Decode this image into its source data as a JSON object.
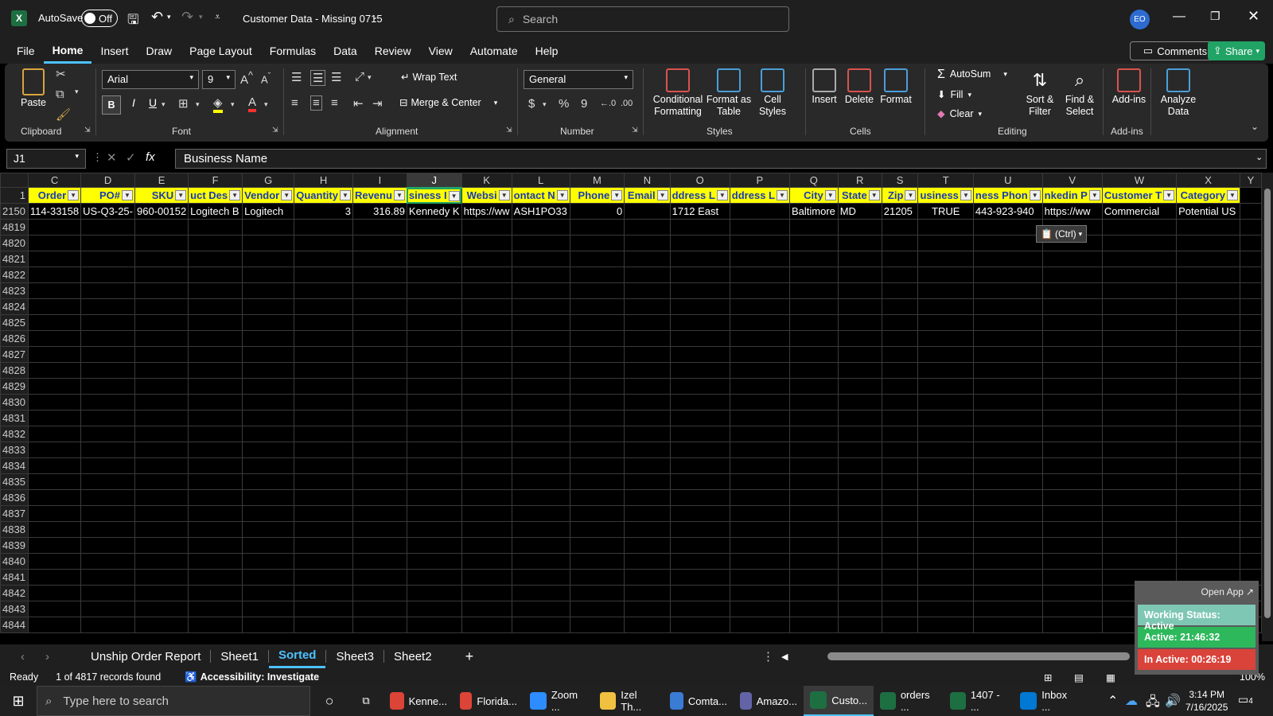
{
  "titlebar": {
    "autosave_label": "AutoSave",
    "autosave_state": "Off",
    "document_title": "Customer Data - Missing 0715",
    "search_placeholder": "Search",
    "avatar_initials": "EO"
  },
  "menu": [
    "File",
    "Home",
    "Insert",
    "Draw",
    "Page Layout",
    "Formulas",
    "Data",
    "Review",
    "View",
    "Automate",
    "Help"
  ],
  "menu_active": "Home",
  "comments_label": "Comments",
  "share_label": "Share",
  "ribbon": {
    "clipboard": {
      "paste": "Paste",
      "label": "Clipboard"
    },
    "font": {
      "name": "Arial",
      "size": "9",
      "label": "Font",
      "bold": "B",
      "italic": "I",
      "underline": "U"
    },
    "alignment": {
      "wrap": "Wrap Text",
      "merge": "Merge & Center",
      "label": "Alignment"
    },
    "number": {
      "format": "General",
      "label": "Number",
      "currency": "$",
      "percent": "%",
      "comma": "9"
    },
    "styles": {
      "conditional": "Conditional Formatting",
      "format_table": "Format as Table",
      "cell_styles": "Cell Styles",
      "label": "Styles"
    },
    "cells": {
      "insert": "Insert",
      "delete": "Delete",
      "format": "Format",
      "label": "Cells"
    },
    "editing": {
      "autosum": "AutoSum",
      "fill": "Fill",
      "clear": "Clear",
      "sort": "Sort & Filter",
      "find": "Find & Select",
      "label": "Editing"
    },
    "addins": {
      "addins": "Add-ins",
      "analyze": "Analyze Data",
      "label": "Add-ins"
    }
  },
  "formula_bar": {
    "name_box": "J1",
    "fx": "fx",
    "content": "Business Name"
  },
  "columns": [
    "C",
    "D",
    "E",
    "F",
    "G",
    "H",
    "I",
    "J",
    "K",
    "L",
    "M",
    "N",
    "O",
    "P",
    "Q",
    "R",
    "S",
    "T",
    "U",
    "V",
    "W",
    "X",
    "Y"
  ],
  "selected_column": "J",
  "header_row": {
    "row_num": "1",
    "cells": [
      "Order",
      "PO#",
      "SKU",
      "uct Des",
      "Vendor",
      "Quantity",
      "Revenu",
      "siness I",
      "Websi",
      "ontact N",
      "Phone",
      "Email",
      "ddress L",
      "ddress L",
      "City",
      "State",
      "Zip",
      "usiness",
      "ness Phon",
      "nkedin P",
      "Customer T",
      "Category",
      ""
    ]
  },
  "data_row": {
    "row_num": "2150",
    "cells": [
      "114-33158",
      "US-Q3-25-",
      "960-00152",
      "Logitech B",
      "Logitech",
      "3",
      "316.89",
      "Kennedy K",
      "https://ww",
      "ASH1PO33",
      "0",
      "",
      "1712 East",
      "",
      "Baltimore",
      "MD",
      "21205",
      "TRUE",
      "443-923-940",
      "https://ww",
      "Commercial",
      "Potential US",
      ""
    ]
  },
  "empty_rows": [
    "4819",
    "4820",
    "4821",
    "4822",
    "4823",
    "4824",
    "4825",
    "4826",
    "4827",
    "4828",
    "4829",
    "4830",
    "4831",
    "4832",
    "4833",
    "4834",
    "4835",
    "4836",
    "4837",
    "4838",
    "4839",
    "4840",
    "4841",
    "4842",
    "4843",
    "4844"
  ],
  "paste_options_label": "(Ctrl)",
  "sheets": [
    "Unship Order Report",
    "Sheet1",
    "Sorted",
    "Sheet3",
    "Sheet2"
  ],
  "active_sheet": "Sorted",
  "status": {
    "mode": "Ready",
    "records": "1 of 4817 records found",
    "accessibility": "Accessibility: Investigate",
    "zoom": "100%"
  },
  "widget": {
    "open_app": "Open App",
    "working": "Working Status: Active",
    "active": "Active: 21:46:32",
    "inactive": "In Active: 00:26:19"
  },
  "taskbar": {
    "search_placeholder": "Type here to search",
    "apps": [
      {
        "label": "Kenne...",
        "icon": "chrome-icon",
        "color": "#db4437"
      },
      {
        "label": "Florida...",
        "icon": "chrome-icon",
        "color": "#db4437"
      },
      {
        "label": "Zoom ...",
        "icon": "zoom-icon",
        "color": "#2d8cff"
      },
      {
        "label": "Izel Th...",
        "icon": "folder-icon",
        "color": "#f0c040"
      },
      {
        "label": "Comta...",
        "icon": "app-icon",
        "color": "#3a7bd5"
      },
      {
        "label": "Amazo...",
        "icon": "teams-icon",
        "color": "#6264a7"
      },
      {
        "label": "Custo...",
        "icon": "excel-icon",
        "color": "#1d6f42"
      },
      {
        "label": "orders ...",
        "icon": "excel-icon",
        "color": "#1d6f42"
      },
      {
        "label": "1407 - ...",
        "icon": "excel-icon",
        "color": "#1d6f42"
      },
      {
        "label": "Inbox ...",
        "icon": "outlook-icon",
        "color": "#0078d4"
      }
    ],
    "time": "3:14 PM",
    "date": "7/16/2025",
    "notifications": "4"
  }
}
